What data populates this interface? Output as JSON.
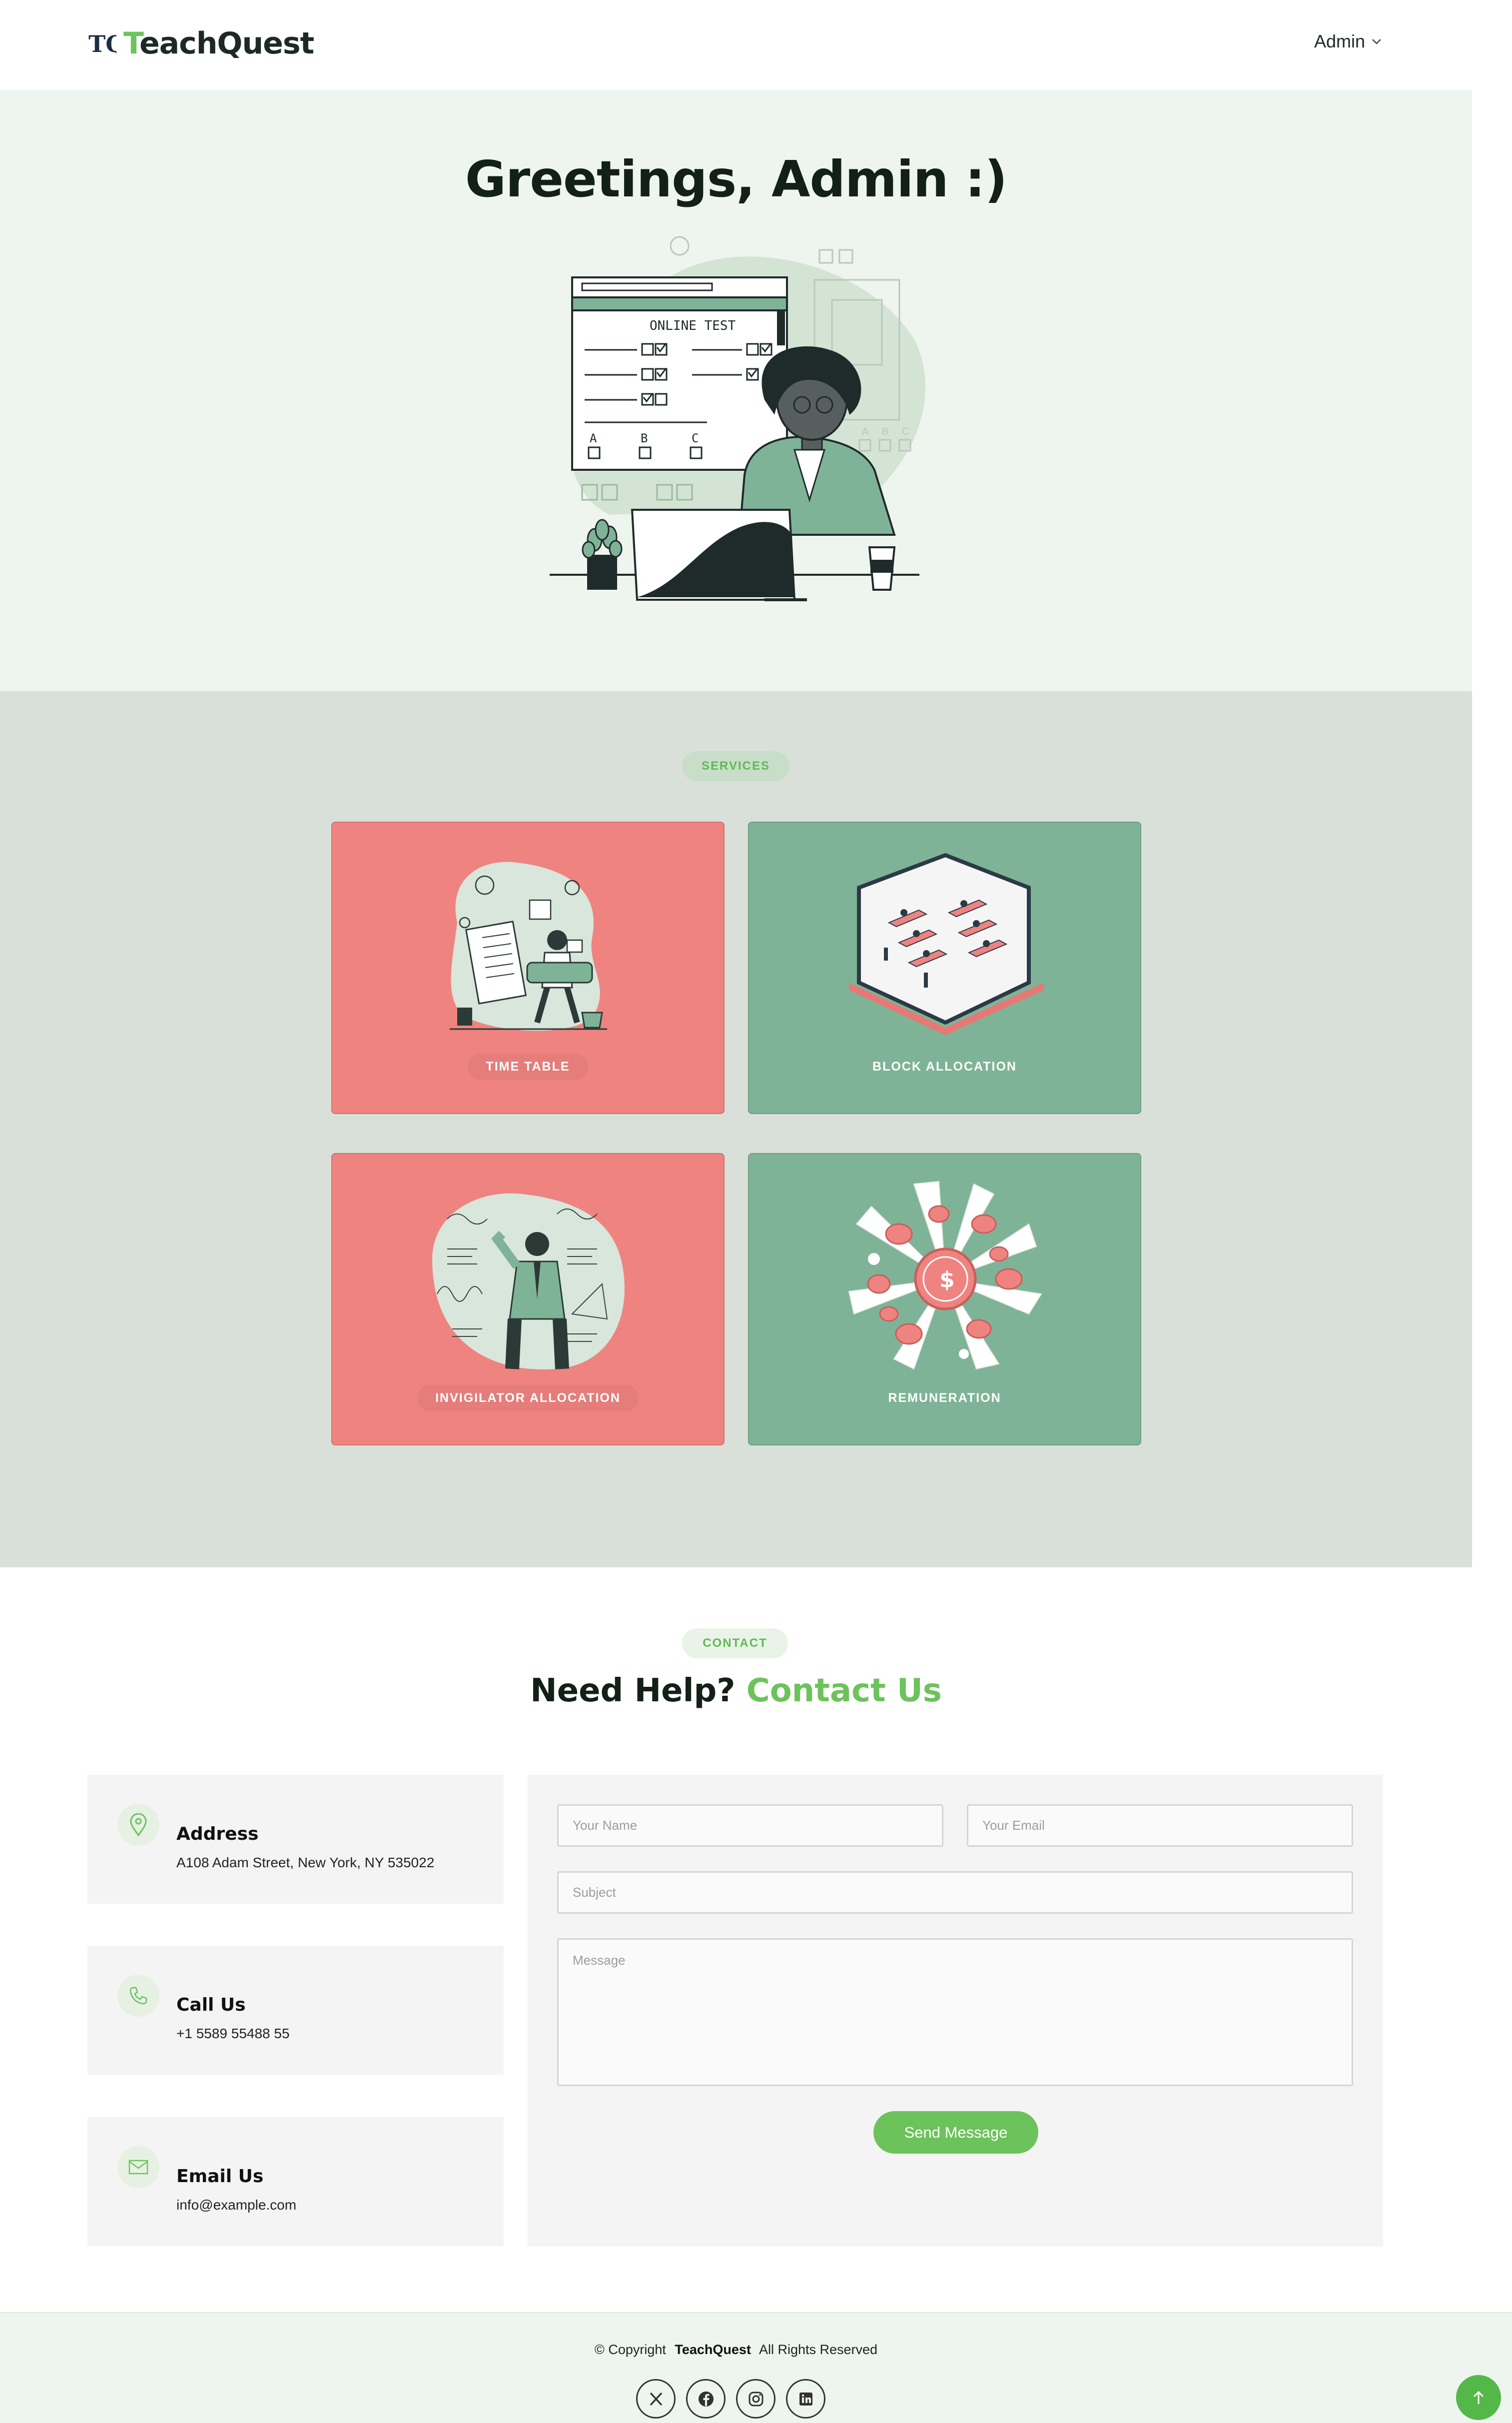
{
  "header": {
    "logo_mark": "TQ",
    "logo_accent": "T",
    "logo_rest": "eachQuest",
    "user_menu": "Admin",
    "user_menu_icon": "chevron-down-icon"
  },
  "hero": {
    "title": "Greetings, Admin :)",
    "illustration": {
      "window_title": "ONLINE TEST",
      "options": [
        "A",
        "B",
        "C"
      ],
      "side_options": [
        "A",
        "B",
        "C"
      ]
    }
  },
  "services": {
    "badge": "SERVICES",
    "cards": [
      {
        "label": "TIME TABLE",
        "color": "#ef8380"
      },
      {
        "label": "BLOCK ALLOCATION",
        "color": "#7fb397"
      },
      {
        "label": "INVIGILATOR ALLOCATION",
        "color": "#ef8380"
      },
      {
        "label": "REMUNERATION",
        "color": "#7fb397"
      }
    ]
  },
  "contact": {
    "badge": "CONTACT",
    "title_plain": "Need Help?",
    "title_accent": "Contact Us",
    "info": [
      {
        "icon": "map-pin-icon",
        "title": "Address",
        "text": "A108 Adam Street, New York, NY 535022"
      },
      {
        "icon": "phone-icon",
        "title": "Call Us",
        "text": "+1 5589 55488 55"
      },
      {
        "icon": "envelope-icon",
        "title": "Email Us",
        "text": "info@example.com"
      }
    ],
    "form": {
      "name_placeholder": "Your Name",
      "email_placeholder": "Your Email",
      "subject_placeholder": "Subject",
      "message_placeholder": "Message",
      "submit_label": "Send Message"
    }
  },
  "footer": {
    "copyright_prefix": "© Copyright",
    "brand": "TeachQuest",
    "copyright_suffix": "All Rights Reserved",
    "socials": [
      "x-twitter-icon",
      "facebook-icon",
      "instagram-icon",
      "linkedin-icon"
    ],
    "back_to_top_icon": "arrow-up-icon"
  },
  "colors": {
    "accent": "#6cc35b",
    "hero_bg": "#eef4ee",
    "services_bg": "#d8e0d9",
    "card_red": "#ef8380",
    "card_green": "#7fb397"
  }
}
